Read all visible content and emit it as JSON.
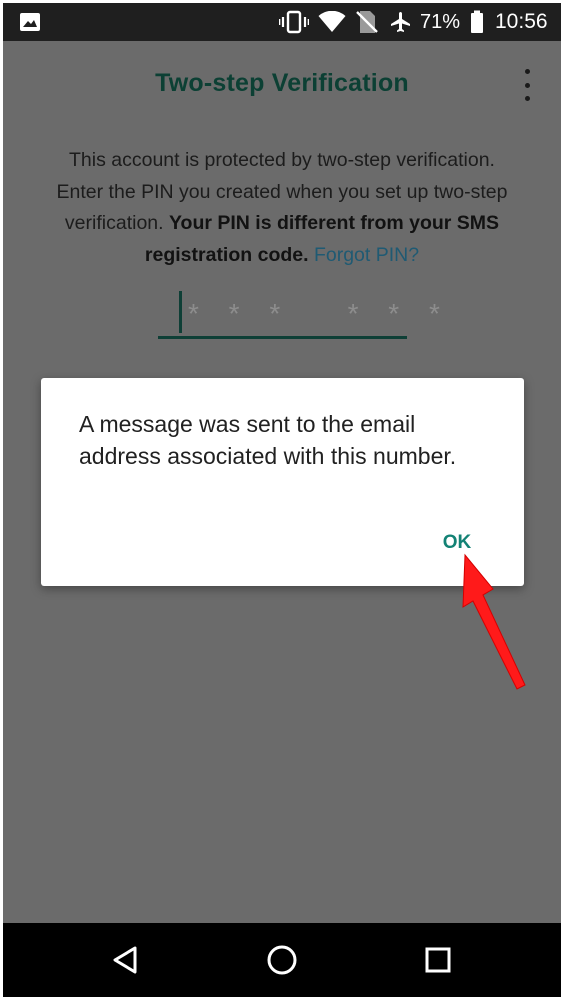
{
  "status_bar": {
    "icons": [
      "image-notification-icon",
      "vibrate-icon",
      "wifi-icon",
      "no-sim-icon",
      "airplane-mode-icon",
      "battery-icon"
    ],
    "battery_percent": "71%",
    "time": "10:56"
  },
  "app_bar": {
    "title": "Two-step Verification",
    "menu_icon": "more-vert-icon"
  },
  "info": {
    "line1": "This account is protected by two-step verification.",
    "line2": "Enter the PIN you created when you set up two-step",
    "line3_plain": "verification. ",
    "line3_bold": "Your PIN is different from your SMS",
    "line4_bold": "registration code.",
    "forgot_link": "Forgot PIN?"
  },
  "pin_input": {
    "placeholder": "* * *   * * *"
  },
  "dialog": {
    "message": "A message was sent to the email address associated with this number.",
    "ok_label": "OK"
  },
  "nav_bar": {
    "back_icon": "back-triangle-icon",
    "home_icon": "home-circle-icon",
    "recents_icon": "recents-square-icon"
  },
  "colors": {
    "title": "#0c4034",
    "link": "#1f5a73",
    "accent": "#138275",
    "annotation_arrow": "#ff1a1a",
    "dim_background": "#6b6b6b"
  }
}
